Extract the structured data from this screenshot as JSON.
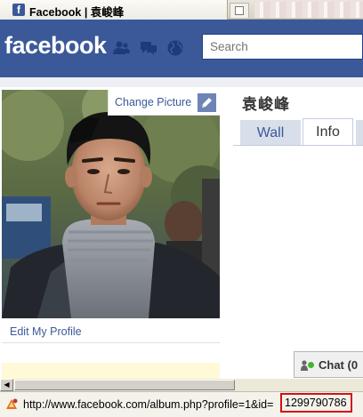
{
  "browser": {
    "tab_title": "Facebook | 袁峻峰",
    "tab_favicon_letter": "f",
    "status_url": "http://www.facebook.com/album.php?profile=1&id=",
    "status_url_highlight": "1299790786"
  },
  "header": {
    "logo": "facebook",
    "search_placeholder": "Search",
    "icons": [
      "friend-requests-icon",
      "messages-icon",
      "notifications-globe-icon"
    ],
    "bar_color": "#3b5998"
  },
  "profile": {
    "change_picture_label": "Change Picture",
    "edit_profile_label": "Edit My Profile",
    "name": "袁峻峰",
    "tabs": [
      {
        "label": "Wall",
        "active": false
      },
      {
        "label": "Info",
        "active": true
      }
    ]
  },
  "chat": {
    "label": "Chat (0",
    "status_color": "#42b72a"
  }
}
